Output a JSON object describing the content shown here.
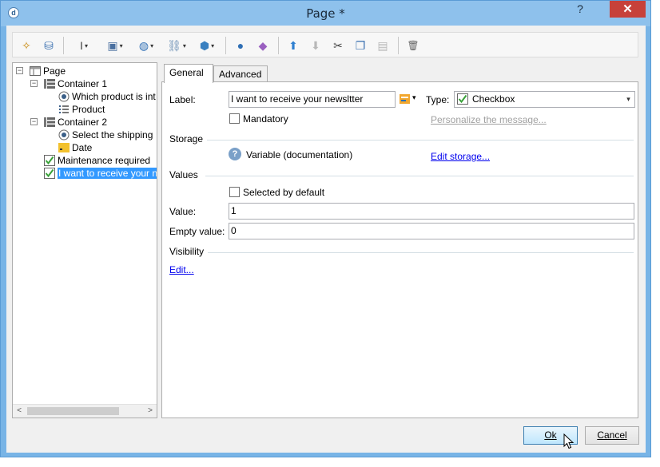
{
  "window": {
    "title": "Page *",
    "help_label": "?",
    "close_label": "✕"
  },
  "toolbar": {
    "tools": [
      {
        "name": "wizard-icon",
        "glyph": "✧"
      },
      {
        "name": "database-refresh-icon",
        "glyph": "⛁"
      },
      {
        "name": "text-cursor-icon",
        "glyph": "Ι"
      },
      {
        "name": "add-field-icon",
        "glyph": "▣"
      },
      {
        "name": "globe-icon",
        "glyph": "◍"
      },
      {
        "name": "link-icon",
        "glyph": "⛓"
      },
      {
        "name": "box-icon",
        "glyph": "⬢"
      },
      {
        "name": "person-icon",
        "glyph": "●"
      },
      {
        "name": "shapes-icon",
        "glyph": "◆"
      },
      {
        "name": "move-up-icon",
        "glyph": "⬆"
      },
      {
        "name": "move-down-icon",
        "glyph": "⬇"
      },
      {
        "name": "cut-icon",
        "glyph": "✂"
      },
      {
        "name": "copy-icon",
        "glyph": "❐"
      },
      {
        "name": "paste-icon",
        "glyph": "▤"
      },
      {
        "name": "delete-icon",
        "glyph": "🗑"
      }
    ],
    "dropdown_glyph": "▾"
  },
  "tree": {
    "items": [
      {
        "label": "Page",
        "level": 0,
        "expander": "−",
        "icon": "page"
      },
      {
        "label": "Container 1",
        "level": 1,
        "expander": "−",
        "icon": "container"
      },
      {
        "label": "Which product is int",
        "level": 2,
        "icon": "radio"
      },
      {
        "label": "Product",
        "level": 2,
        "icon": "list"
      },
      {
        "label": "Container 2",
        "level": 1,
        "expander": "−",
        "icon": "container"
      },
      {
        "label": "Select the shipping",
        "level": 2,
        "icon": "radio"
      },
      {
        "label": "Date",
        "level": 2,
        "icon": "date"
      },
      {
        "label": "Maintenance required",
        "level": 1,
        "icon": "checkbox"
      },
      {
        "label": "I want to receive your ne",
        "level": 1,
        "icon": "checkbox",
        "selected": true
      }
    ],
    "scroll_left": "<",
    "scroll_right": ">"
  },
  "tabs": [
    {
      "label": "General",
      "active": true
    },
    {
      "label": "Advanced",
      "active": false
    }
  ],
  "general": {
    "label_caption": "Label:",
    "label_value": "I want to receive your newsltter",
    "type_caption": "Type:",
    "type_value": "Checkbox",
    "mandatory_label": "Mandatory",
    "personalize_link": "Personalize the message...",
    "storage_section": "Storage",
    "storage_help": "?",
    "storage_variable": "Variable (documentation)",
    "edit_storage_link": "Edit storage...",
    "values_section": "Values",
    "selected_default_label": "Selected by default",
    "value_caption": "Value:",
    "value_value": "1",
    "empty_value_caption": "Empty value:",
    "empty_value_value": "0",
    "visibility_section": "Visibility",
    "visibility_edit_link": "Edit..."
  },
  "buttons": {
    "ok": "Ok",
    "cancel": "Cancel"
  },
  "colors": {
    "titlebar": "#8ec1ec",
    "selection": "#3399ff",
    "close_button": "#c7413a",
    "link": "#0000ee"
  }
}
